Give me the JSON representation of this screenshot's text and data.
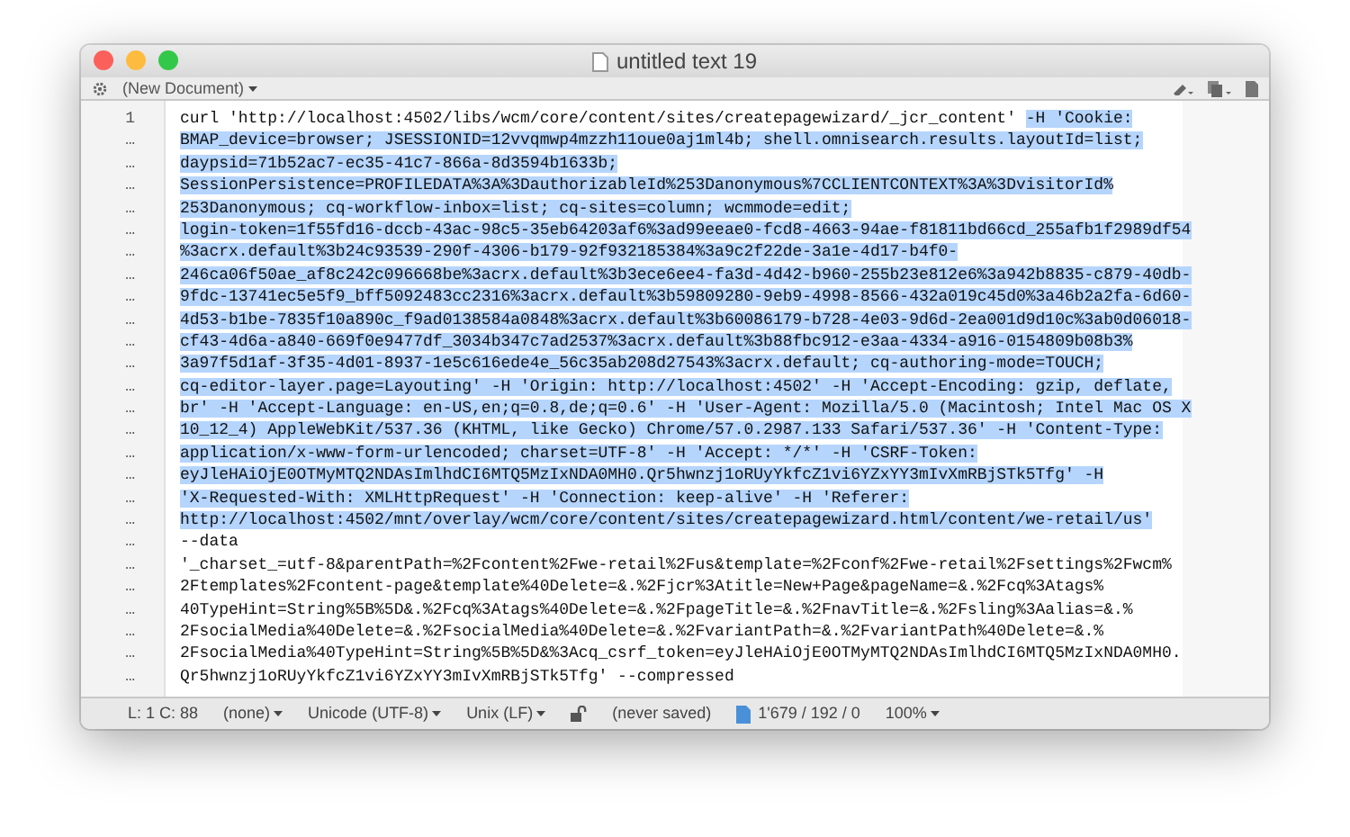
{
  "window": {
    "title": "untitled text 19"
  },
  "toolbar": {
    "document_mode": "(New Document)"
  },
  "lines": [
    {
      "number": "1",
      "segments": [
        {
          "text": "curl 'http://localhost:4502/libs/wcm/core/content/sites/createpagewizard/_jcr_content' ",
          "selected": false
        },
        {
          "text": "-H 'Cookie:",
          "selected": true
        }
      ]
    },
    {
      "number": "…",
      "segments": [
        {
          "text": "BMAP_device=browser; JSESSIONID=12vvqmwp4mzzh11oue0aj1ml4b; shell.omnisearch.results.layoutId=list;",
          "selected": true
        }
      ]
    },
    {
      "number": "…",
      "segments": [
        {
          "text": "daypsid=71b52ac7-ec35-41c7-866a-8d3594b1633b;",
          "selected": true
        }
      ]
    },
    {
      "number": "…",
      "segments": [
        {
          "text": "SessionPersistence=PROFILEDATA%3A%3DauthorizableId%253Danonymous%7CCLIENTCONTEXT%3A%3DvisitorId%",
          "selected": true
        }
      ]
    },
    {
      "number": "…",
      "segments": [
        {
          "text": "253Danonymous; cq-workflow-inbox=list; cq-sites=column; wcmmode=edit;",
          "selected": true
        }
      ]
    },
    {
      "number": "…",
      "segments": [
        {
          "text": "login-token=1f55fd16-dccb-43ac-98c5-35eb64203af6%3ad99eeae0-fcd8-4663-94ae-f81811bd66cd_255afb1f2989df54",
          "selected": true
        }
      ]
    },
    {
      "number": "…",
      "segments": [
        {
          "text": "%3acrx.default%3b24c93539-290f-4306-b179-92f932185384%3a9c2f22de-3a1e-4d17-b4f0-",
          "selected": true
        }
      ]
    },
    {
      "number": "…",
      "segments": [
        {
          "text": "246ca06f50ae_af8c242c096668be%3acrx.default%3b3ece6ee4-fa3d-4d42-b960-255b23e812e6%3a942b8835-c879-40db-",
          "selected": true
        }
      ]
    },
    {
      "number": "…",
      "segments": [
        {
          "text": "9fdc-13741ec5e5f9_bff5092483cc2316%3acrx.default%3b59809280-9eb9-4998-8566-432a019c45d0%3a46b2a2fa-6d60-",
          "selected": true
        }
      ]
    },
    {
      "number": "…",
      "segments": [
        {
          "text": "4d53-b1be-7835f10a890c_f9ad0138584a0848%3acrx.default%3b60086179-b728-4e03-9d6d-2ea001d9d10c%3ab0d06018-",
          "selected": true
        }
      ]
    },
    {
      "number": "…",
      "segments": [
        {
          "text": "cf43-4d6a-a840-669f0e9477df_3034b347c7ad2537%3acrx.default%3b88fbc912-e3aa-4334-a916-0154809b08b3%",
          "selected": true
        }
      ]
    },
    {
      "number": "…",
      "segments": [
        {
          "text": "3a97f5d1af-3f35-4d01-8937-1e5c616ede4e_56c35ab208d27543%3acrx.default; cq-authoring-mode=TOUCH;",
          "selected": true
        }
      ]
    },
    {
      "number": "…",
      "segments": [
        {
          "text": "cq-editor-layer.page=Layouting' -H 'Origin: http://localhost:4502' -H 'Accept-Encoding: gzip, deflate,",
          "selected": true
        }
      ]
    },
    {
      "number": "…",
      "segments": [
        {
          "text": "br' -H 'Accept-Language: en-US,en;q=0.8,de;q=0.6' -H 'User-Agent: Mozilla/5.0 (Macintosh; Intel Mac OS X",
          "selected": true
        }
      ]
    },
    {
      "number": "…",
      "segments": [
        {
          "text": "10_12_4) AppleWebKit/537.36 (KHTML, like Gecko) Chrome/57.0.2987.133 Safari/537.36' -H 'Content-Type:",
          "selected": true
        }
      ]
    },
    {
      "number": "…",
      "segments": [
        {
          "text": "application/x-www-form-urlencoded; charset=UTF-8' -H 'Accept: */*' -H 'CSRF-Token:",
          "selected": true
        }
      ]
    },
    {
      "number": "…",
      "segments": [
        {
          "text": "eyJleHAiOjE0OTMyMTQ2NDAsImlhdCI6MTQ5MzIxNDA0MH0.Qr5hwnzj1oRUyYkfcZ1vi6YZxYY3mIvXmRBjSTk5Tfg' -H",
          "selected": true
        }
      ]
    },
    {
      "number": "…",
      "segments": [
        {
          "text": "'X-Requested-With: XMLHttpRequest' -H 'Connection: keep-alive' -H 'Referer:",
          "selected": true
        }
      ]
    },
    {
      "number": "…",
      "segments": [
        {
          "text": "http://localhost:4502/mnt/overlay/wcm/core/content/sites/createpagewizard.html/content/we-retail/us'",
          "selected": true
        }
      ]
    },
    {
      "number": "…",
      "segments": [
        {
          "text": "--data",
          "selected": false
        }
      ]
    },
    {
      "number": "…",
      "segments": [
        {
          "text": "'_charset_=utf-8&parentPath=%2Fcontent%2Fwe-retail%2Fus&template=%2Fconf%2Fwe-retail%2Fsettings%2Fwcm%",
          "selected": false
        }
      ]
    },
    {
      "number": "…",
      "segments": [
        {
          "text": "2Ftemplates%2Fcontent-page&template%40Delete=&.%2Fjcr%3Atitle=New+Page&pageName=&.%2Fcq%3Atags%",
          "selected": false
        }
      ]
    },
    {
      "number": "…",
      "segments": [
        {
          "text": "40TypeHint=String%5B%5D&.%2Fcq%3Atags%40Delete=&.%2FpageTitle=&.%2FnavTitle=&.%2Fsling%3Aalias=&.%",
          "selected": false
        }
      ]
    },
    {
      "number": "…",
      "segments": [
        {
          "text": "2FsocialMedia%40Delete=&.%2FsocialMedia%40Delete=&.%2FvariantPath=&.%2FvariantPath%40Delete=&.%",
          "selected": false
        }
      ]
    },
    {
      "number": "…",
      "segments": [
        {
          "text": "2FsocialMedia%40TypeHint=String%5B%5D&%3Acq_csrf_token=eyJleHAiOjE0OTMyMTQ2NDAsImlhdCI6MTQ5MzIxNDA0MH0.",
          "selected": false
        }
      ]
    },
    {
      "number": "…",
      "segments": [
        {
          "text": "Qr5hwnzj1oRUyYkfcZ1vi6YZxYY3mIvXmRBjSTk5Tfg' --compressed",
          "selected": false
        }
      ]
    }
  ],
  "status_bar": [
    {
      "kind": "text",
      "text": "L: 1 C: 88"
    },
    {
      "kind": "dropdown",
      "text": "(none)"
    },
    {
      "kind": "dropdown",
      "text": "Unicode (UTF-8)"
    },
    {
      "kind": "dropdown",
      "text": "Unix (LF)"
    },
    {
      "kind": "lock"
    },
    {
      "kind": "text",
      "text": "(never saved)"
    },
    {
      "kind": "doc"
    },
    {
      "kind": "text",
      "text": "1'679 / 192 / 0"
    },
    {
      "kind": "dropdown",
      "text": "100%"
    }
  ]
}
